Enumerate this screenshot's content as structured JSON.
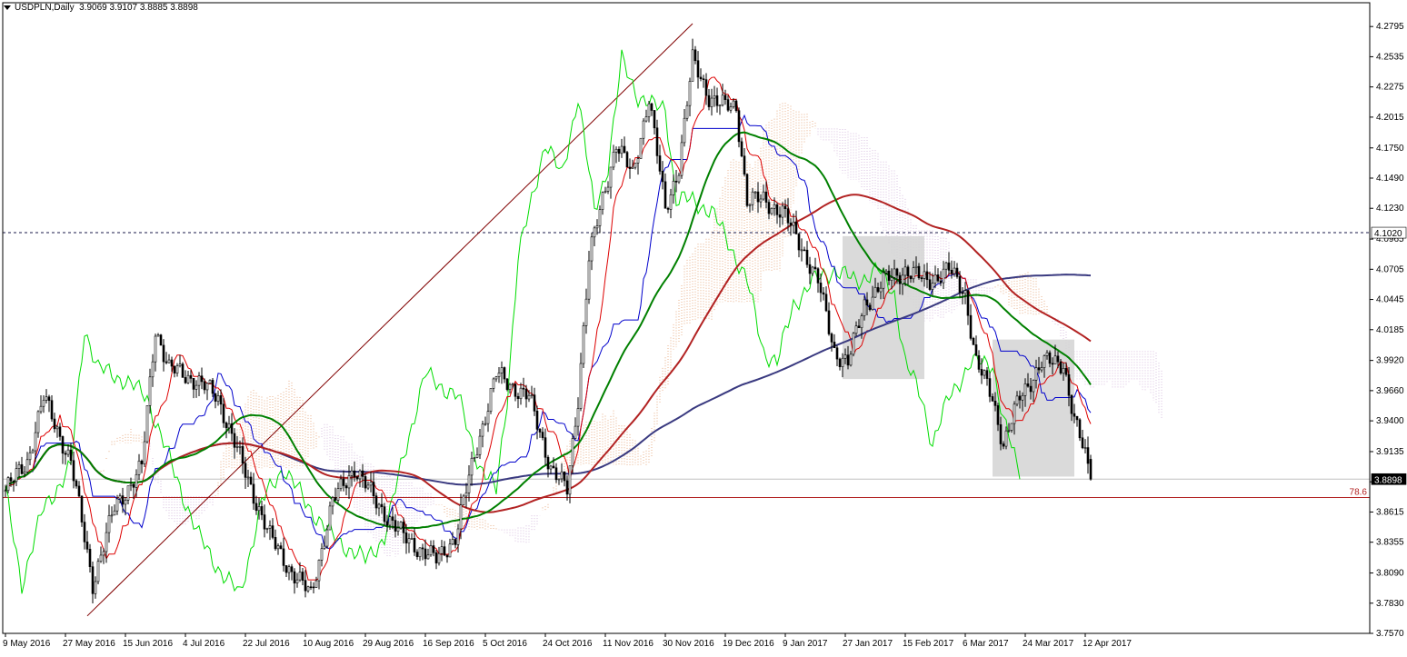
{
  "header": {
    "symbol": "USDPLN,Daily",
    "ohlc": "3.9069 3.9107 3.8885 3.8898"
  },
  "price_tags": {
    "hline_price": "4.1020",
    "last_price": "3.8898",
    "fib_label": "78.6"
  },
  "colors": {
    "background": "#ffffff",
    "grid_text": "#000000",
    "green_ma": "#008000",
    "red_ma": "#b22222",
    "navy_ma": "#3a3a80",
    "chikou": "#00dd00",
    "kijun": "#0000cc",
    "tenkan": "#dd0000",
    "kumo_bull": "#e8b088",
    "kumo_bear": "#d8c0e0",
    "box": "#d3d3d3",
    "fib_line": "#b22222",
    "last_tag_bg": "#000000",
    "trend_line": "#800000"
  },
  "chart_data": {
    "type": "candlestick",
    "title": "USDPLN,Daily",
    "ylim": [
      3.757,
      4.3
    ],
    "y_ticks": [
      "4.2795",
      "4.2535",
      "4.2275",
      "4.2015",
      "4.1750",
      "4.1490",
      "4.1230",
      "4.0965",
      "4.0705",
      "4.0445",
      "4.0185",
      "3.9920",
      "3.9660",
      "3.9400",
      "3.9135",
      "3.8875",
      "3.8615",
      "3.8355",
      "3.8090",
      "3.7830",
      "3.7570"
    ],
    "x_labels": [
      "9 May 2016",
      "27 May 2016",
      "15 Jun 2016",
      "4 Jul 2016",
      "22 Jul 2016",
      "10 Aug 2016",
      "29 Aug 2016",
      "16 Sep 2016",
      "5 Oct 2016",
      "24 Oct 2016",
      "11 Nov 2016",
      "30 Nov 2016",
      "19 Dec 2016",
      "9 Jan 2017",
      "27 Jan 2017",
      "15 Feb 2017",
      "6 Mar 2017",
      "24 Mar 2017",
      "12 Apr 2017"
    ],
    "horizontal_lines": [
      {
        "price": 4.102,
        "style": "dashed"
      },
      {
        "price": 3.8898,
        "style": "solid",
        "role": "last"
      },
      {
        "price": 3.874,
        "style": "solid",
        "label": "78.6"
      }
    ],
    "trend_lines": [
      {
        "from": [
          30,
          3.772
        ],
        "to": [
          252,
          4.282
        ]
      }
    ],
    "boxes": [
      {
        "bar_from": 307,
        "bar_to": 337,
        "price_top": 4.099,
        "price_bottom": 3.976
      },
      {
        "bar_from": 362,
        "bar_to": 392,
        "price_top": 4.01,
        "price_bottom": 3.892
      }
    ],
    "anchor_closes": [
      [
        0,
        3.88
      ],
      [
        8,
        3.905
      ],
      [
        14,
        3.96
      ],
      [
        24,
        3.905
      ],
      [
        32,
        3.8
      ],
      [
        40,
        3.865
      ],
      [
        50,
        3.9
      ],
      [
        55,
        4.02
      ],
      [
        60,
        3.985
      ],
      [
        70,
        3.975
      ],
      [
        78,
        3.96
      ],
      [
        88,
        3.895
      ],
      [
        97,
        3.84
      ],
      [
        105,
        3.81
      ],
      [
        112,
        3.79
      ],
      [
        120,
        3.87
      ],
      [
        128,
        3.9
      ],
      [
        136,
        3.87
      ],
      [
        146,
        3.84
      ],
      [
        158,
        3.82
      ],
      [
        165,
        3.84
      ],
      [
        172,
        3.91
      ],
      [
        180,
        3.98
      ],
      [
        192,
        3.96
      ],
      [
        200,
        3.9
      ],
      [
        206,
        3.88
      ],
      [
        210,
        3.96
      ],
      [
        214,
        4.08
      ],
      [
        218,
        4.12
      ],
      [
        224,
        4.18
      ],
      [
        230,
        4.15
      ],
      [
        236,
        4.22
      ],
      [
        242,
        4.12
      ],
      [
        247,
        4.16
      ],
      [
        252,
        4.25
      ],
      [
        258,
        4.22
      ],
      [
        264,
        4.21
      ],
      [
        268,
        4.21
      ],
      [
        272,
        4.13
      ],
      [
        278,
        4.13
      ],
      [
        285,
        4.12
      ],
      [
        292,
        4.09
      ],
      [
        298,
        4.06
      ],
      [
        304,
        4.0
      ],
      [
        309,
        3.99
      ],
      [
        315,
        4.04
      ],
      [
        322,
        4.06
      ],
      [
        330,
        4.07
      ],
      [
        338,
        4.06
      ],
      [
        346,
        4.07
      ],
      [
        352,
        4.05
      ],
      [
        356,
        3.99
      ],
      [
        362,
        3.96
      ],
      [
        366,
        3.92
      ],
      [
        372,
        3.96
      ],
      [
        380,
        3.99
      ],
      [
        388,
        3.99
      ],
      [
        392,
        3.94
      ],
      [
        396,
        3.91
      ],
      [
        398,
        3.8898
      ]
    ]
  }
}
